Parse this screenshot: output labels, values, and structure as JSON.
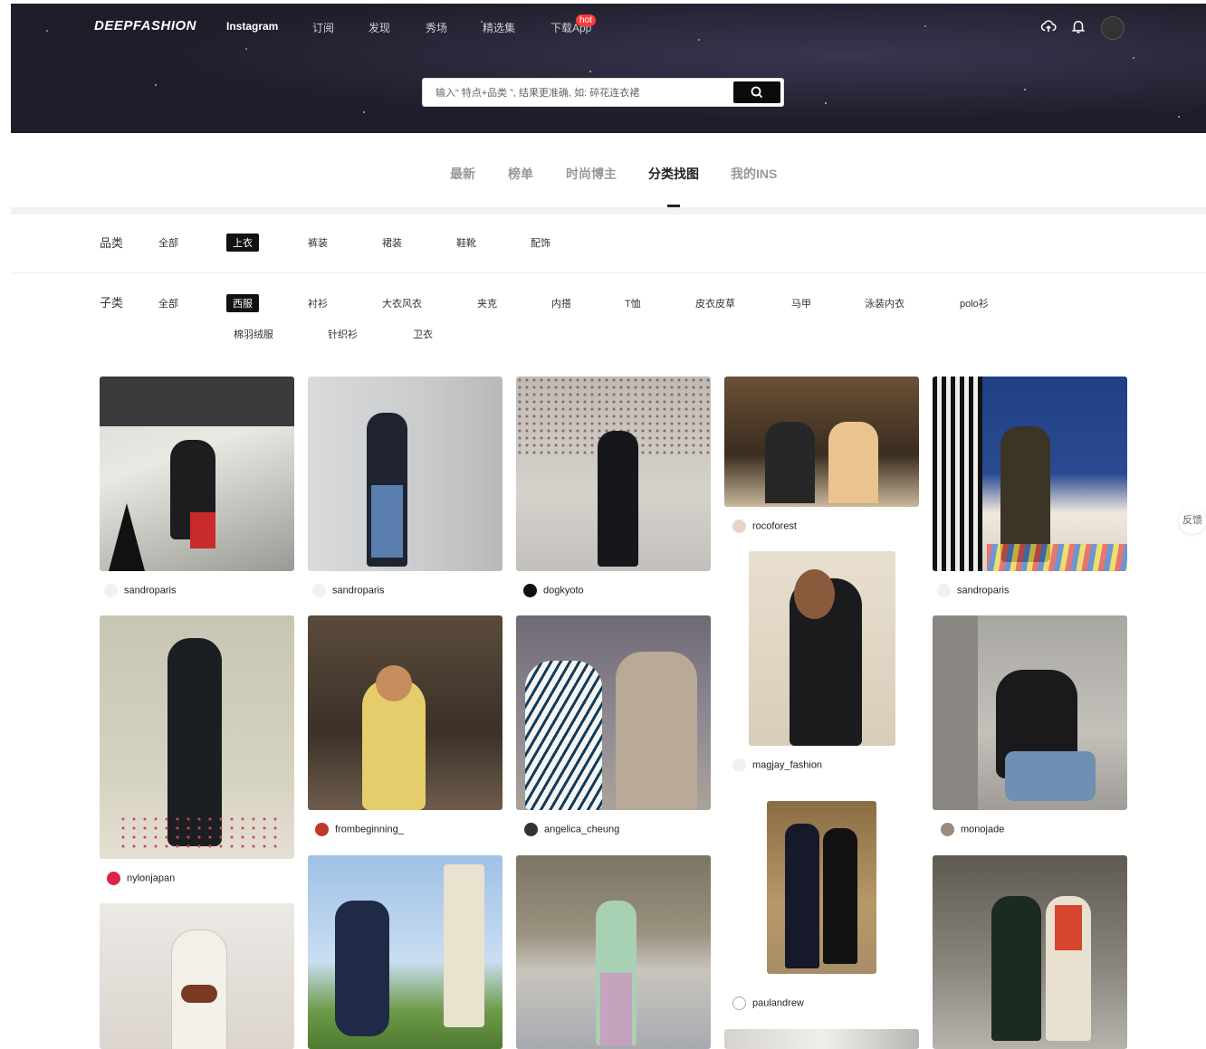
{
  "header": {
    "logo": "DEEPFASHION",
    "nav": [
      {
        "label": "Instagram",
        "active": true
      },
      {
        "label": "订阅"
      },
      {
        "label": "发现"
      },
      {
        "label": "秀场"
      },
      {
        "label": "精选集"
      },
      {
        "label": "下载App"
      }
    ],
    "hot_badge": "hot",
    "icons": [
      "cloud-upload-icon",
      "bell-icon",
      "avatar"
    ],
    "search_placeholder": "输入“ 特点+品类 ”, 结果更准确, 如: 碎花连衣裙"
  },
  "tabs": [
    {
      "label": "最新"
    },
    {
      "label": "榜单"
    },
    {
      "label": "时尚博主"
    },
    {
      "label": "分类找图",
      "active": true
    },
    {
      "label": "我的INS"
    }
  ],
  "filters": {
    "category_label": "品类",
    "category_options": [
      "全部",
      "上衣",
      "裤装",
      "裙装",
      "鞋靴",
      "配饰"
    ],
    "category_selected": "上衣",
    "sub_label": "子类",
    "sub_options_row1": [
      "全部",
      "西服",
      "衬衫",
      "大衣风衣",
      "夹克",
      "内搭",
      "T恤",
      "皮衣皮草",
      "马甲",
      "泳装内衣",
      "polo衫"
    ],
    "sub_options_row2": [
      "棉羽绒服",
      "针织衫",
      "卫衣"
    ],
    "sub_selected": "西服"
  },
  "feed": [
    {
      "user": "sandroparis"
    },
    {
      "user": "sandroparis"
    },
    {
      "user": "dogkyoto"
    },
    {
      "user": "rocoforest"
    },
    {
      "user": "sandroparis"
    },
    {
      "user": "nylonjapan"
    },
    {
      "user": "frombeginning_"
    },
    {
      "user": "angelica_cheung"
    },
    {
      "user": "magjay_fashion"
    },
    {
      "user": "monojade"
    },
    {
      "user": "paulandrew"
    }
  ],
  "feedback_label": "反馈",
  "colors": {
    "accent": "#111111",
    "hot": "#ff3b3b"
  }
}
